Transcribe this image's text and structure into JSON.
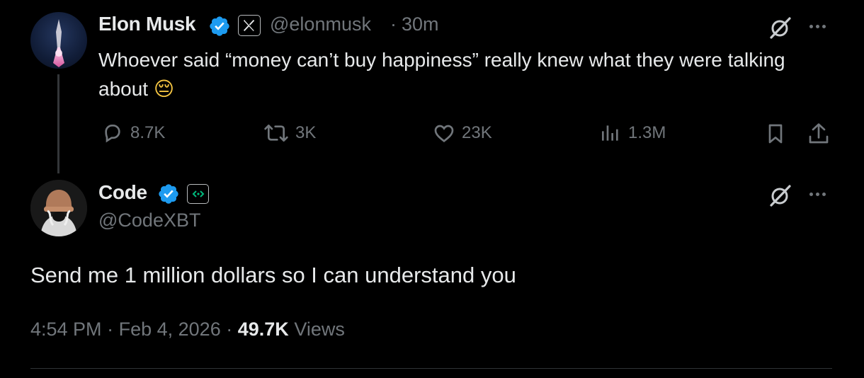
{
  "tweet": {
    "author_name": "Elon Musk",
    "author_handle": "@elonmusk",
    "separator": "·",
    "time_ago": "30m",
    "text": "Whoever said “money can’t buy happiness” really knew what they were talking about",
    "emoji": "😔",
    "stats": {
      "replies": "8.7K",
      "reposts": "3K",
      "likes": "23K",
      "views": "1.3M"
    }
  },
  "reply": {
    "author_name": "Code",
    "author_handle": "@CodeXBT",
    "text": "Send me 1 million dollars so I can understand you",
    "time": "4:54 PM",
    "separator1": "·",
    "date": "Feb 4, 2026",
    "separator2": "·",
    "views_count": "49.7K",
    "views_label": "Views"
  },
  "icons": {
    "verified": "verified-badge-icon",
    "x_affiliate": "x-logo-icon",
    "grok": "grok-icon",
    "more": "more-icon",
    "reply": "reply-icon",
    "repost": "repost-icon",
    "like": "heart-icon",
    "views": "views-chart-icon",
    "bookmark": "bookmark-icon",
    "share": "share-icon"
  },
  "colors": {
    "background": "#000000",
    "text_primary": "#e7e9ea",
    "text_secondary": "#71767b",
    "verified_blue": "#1d9bf0",
    "affiliate_green": "#00ba7c"
  }
}
